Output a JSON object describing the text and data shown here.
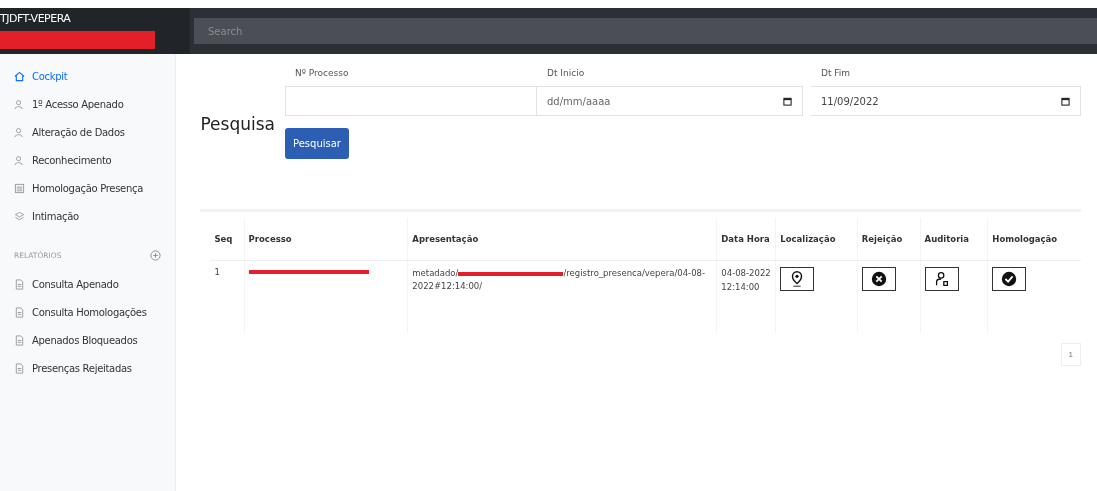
{
  "header": {
    "brand": "TJDFT-VEPERA",
    "search": {
      "placeholder": "Search"
    }
  },
  "sidebar": {
    "items": [
      {
        "label": "Cockpit",
        "kind": "home",
        "selected": true
      },
      {
        "label": "1º Acesso Apenado",
        "kind": "user",
        "selected": false
      },
      {
        "label": "Alteração de Dados",
        "kind": "user",
        "selected": false
      },
      {
        "label": "Reconhecimento",
        "kind": "user",
        "selected": false
      },
      {
        "label": "Homologação Presença",
        "kind": "list",
        "selected": false
      },
      {
        "label": "Intimação",
        "kind": "layers",
        "selected": false
      }
    ],
    "section": "RELATÓRIOS",
    "reports": [
      {
        "label": "Consulta Apenado",
        "selected": false
      },
      {
        "label": "Consulta Homologações",
        "selected": false
      },
      {
        "label": "Apenados Bloqueados",
        "selected": false
      },
      {
        "label": "Presenças Rejeitadas",
        "selected": false
      }
    ]
  },
  "search_form": {
    "heading": "Pesquisa",
    "fields": [
      {
        "label": "Nº Processo",
        "kind": "text"
      },
      {
        "label": "Dt Inicio",
        "kind": "date",
        "placeholder": "dd/mm/aaaa"
      },
      {
        "label": "Dt Fim",
        "kind": "date",
        "value": "11/09/2022"
      }
    ],
    "button": "Pesquisar"
  },
  "table": {
    "columns": [
      "Seq",
      "Processo",
      "Apresentação",
      "Data Hora",
      "Localização",
      "Rejeição",
      "Auditoria",
      "Homologação"
    ],
    "rows": [
      {
        "seq": "1",
        "apresentacao_prefix": "metadado/",
        "apresentacao_suffix": "/registro_presenca/vepera/04-08-2022#12:14:00/",
        "data_hora": "04-08-2022 12:14:00"
      }
    ]
  },
  "pagination": [
    "1"
  ]
}
